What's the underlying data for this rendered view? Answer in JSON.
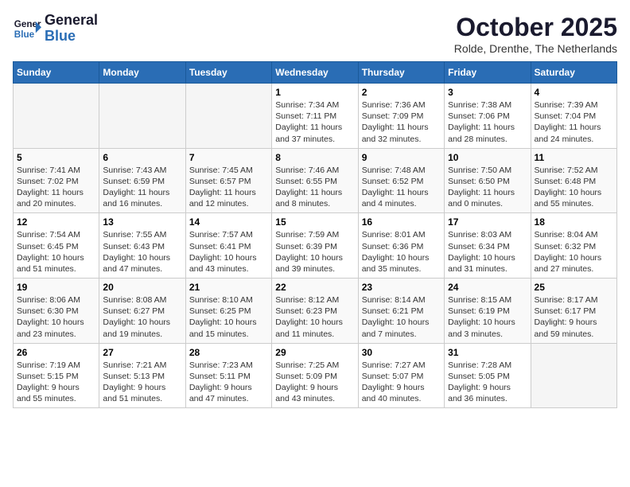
{
  "header": {
    "logo_line1": "General",
    "logo_line2": "Blue",
    "title": "October 2025",
    "location": "Rolde, Drenthe, The Netherlands"
  },
  "weekdays": [
    "Sunday",
    "Monday",
    "Tuesday",
    "Wednesday",
    "Thursday",
    "Friday",
    "Saturday"
  ],
  "weeks": [
    [
      {
        "day": "",
        "info": ""
      },
      {
        "day": "",
        "info": ""
      },
      {
        "day": "",
        "info": ""
      },
      {
        "day": "1",
        "info": "Sunrise: 7:34 AM\nSunset: 7:11 PM\nDaylight: 11 hours\nand 37 minutes."
      },
      {
        "day": "2",
        "info": "Sunrise: 7:36 AM\nSunset: 7:09 PM\nDaylight: 11 hours\nand 32 minutes."
      },
      {
        "day": "3",
        "info": "Sunrise: 7:38 AM\nSunset: 7:06 PM\nDaylight: 11 hours\nand 28 minutes."
      },
      {
        "day": "4",
        "info": "Sunrise: 7:39 AM\nSunset: 7:04 PM\nDaylight: 11 hours\nand 24 minutes."
      }
    ],
    [
      {
        "day": "5",
        "info": "Sunrise: 7:41 AM\nSunset: 7:02 PM\nDaylight: 11 hours\nand 20 minutes."
      },
      {
        "day": "6",
        "info": "Sunrise: 7:43 AM\nSunset: 6:59 PM\nDaylight: 11 hours\nand 16 minutes."
      },
      {
        "day": "7",
        "info": "Sunrise: 7:45 AM\nSunset: 6:57 PM\nDaylight: 11 hours\nand 12 minutes."
      },
      {
        "day": "8",
        "info": "Sunrise: 7:46 AM\nSunset: 6:55 PM\nDaylight: 11 hours\nand 8 minutes."
      },
      {
        "day": "9",
        "info": "Sunrise: 7:48 AM\nSunset: 6:52 PM\nDaylight: 11 hours\nand 4 minutes."
      },
      {
        "day": "10",
        "info": "Sunrise: 7:50 AM\nSunset: 6:50 PM\nDaylight: 11 hours\nand 0 minutes."
      },
      {
        "day": "11",
        "info": "Sunrise: 7:52 AM\nSunset: 6:48 PM\nDaylight: 10 hours\nand 55 minutes."
      }
    ],
    [
      {
        "day": "12",
        "info": "Sunrise: 7:54 AM\nSunset: 6:45 PM\nDaylight: 10 hours\nand 51 minutes."
      },
      {
        "day": "13",
        "info": "Sunrise: 7:55 AM\nSunset: 6:43 PM\nDaylight: 10 hours\nand 47 minutes."
      },
      {
        "day": "14",
        "info": "Sunrise: 7:57 AM\nSunset: 6:41 PM\nDaylight: 10 hours\nand 43 minutes."
      },
      {
        "day": "15",
        "info": "Sunrise: 7:59 AM\nSunset: 6:39 PM\nDaylight: 10 hours\nand 39 minutes."
      },
      {
        "day": "16",
        "info": "Sunrise: 8:01 AM\nSunset: 6:36 PM\nDaylight: 10 hours\nand 35 minutes."
      },
      {
        "day": "17",
        "info": "Sunrise: 8:03 AM\nSunset: 6:34 PM\nDaylight: 10 hours\nand 31 minutes."
      },
      {
        "day": "18",
        "info": "Sunrise: 8:04 AM\nSunset: 6:32 PM\nDaylight: 10 hours\nand 27 minutes."
      }
    ],
    [
      {
        "day": "19",
        "info": "Sunrise: 8:06 AM\nSunset: 6:30 PM\nDaylight: 10 hours\nand 23 minutes."
      },
      {
        "day": "20",
        "info": "Sunrise: 8:08 AM\nSunset: 6:27 PM\nDaylight: 10 hours\nand 19 minutes."
      },
      {
        "day": "21",
        "info": "Sunrise: 8:10 AM\nSunset: 6:25 PM\nDaylight: 10 hours\nand 15 minutes."
      },
      {
        "day": "22",
        "info": "Sunrise: 8:12 AM\nSunset: 6:23 PM\nDaylight: 10 hours\nand 11 minutes."
      },
      {
        "day": "23",
        "info": "Sunrise: 8:14 AM\nSunset: 6:21 PM\nDaylight: 10 hours\nand 7 minutes."
      },
      {
        "day": "24",
        "info": "Sunrise: 8:15 AM\nSunset: 6:19 PM\nDaylight: 10 hours\nand 3 minutes."
      },
      {
        "day": "25",
        "info": "Sunrise: 8:17 AM\nSunset: 6:17 PM\nDaylight: 9 hours\nand 59 minutes."
      }
    ],
    [
      {
        "day": "26",
        "info": "Sunrise: 7:19 AM\nSunset: 5:15 PM\nDaylight: 9 hours\nand 55 minutes."
      },
      {
        "day": "27",
        "info": "Sunrise: 7:21 AM\nSunset: 5:13 PM\nDaylight: 9 hours\nand 51 minutes."
      },
      {
        "day": "28",
        "info": "Sunrise: 7:23 AM\nSunset: 5:11 PM\nDaylight: 9 hours\nand 47 minutes."
      },
      {
        "day": "29",
        "info": "Sunrise: 7:25 AM\nSunset: 5:09 PM\nDaylight: 9 hours\nand 43 minutes."
      },
      {
        "day": "30",
        "info": "Sunrise: 7:27 AM\nSunset: 5:07 PM\nDaylight: 9 hours\nand 40 minutes."
      },
      {
        "day": "31",
        "info": "Sunrise: 7:28 AM\nSunset: 5:05 PM\nDaylight: 9 hours\nand 36 minutes."
      },
      {
        "day": "",
        "info": ""
      }
    ]
  ]
}
